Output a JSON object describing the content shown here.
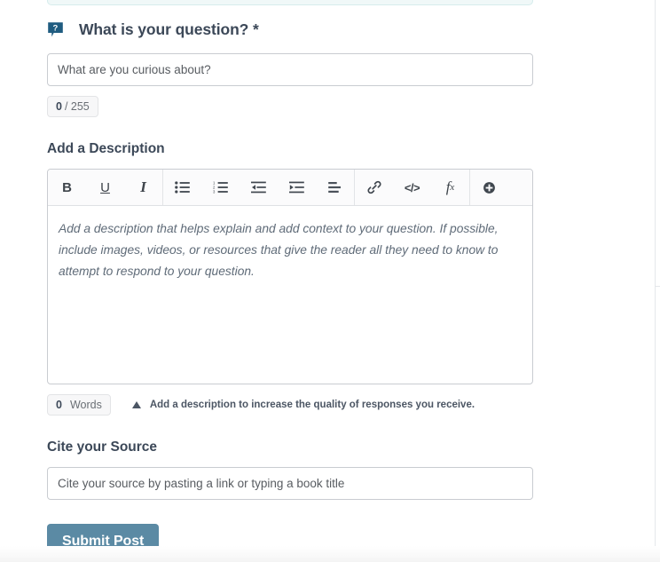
{
  "form": {
    "question": {
      "icon": "question-speech-bubble-icon",
      "label": "What is your question? *",
      "placeholder": "What are you curious about?",
      "value": "",
      "counter_current": "0",
      "counter_rest": "/ 255"
    },
    "description": {
      "heading": "Add a Description",
      "placeholder": "Add a description that helps explain and add context to your question. If possible, include images, videos, or resources that give the reader all they need to know to attempt to respond to your question.",
      "value": "",
      "word_count": "0",
      "word_unit": "Words",
      "hint": "Add a description to increase the quality of responses you receive.",
      "hint_icon": "warning-triangle-icon",
      "toolbar": [
        {
          "name": "bold-button",
          "label": "B",
          "kind": "text"
        },
        {
          "name": "underline-button",
          "label": "U",
          "kind": "text"
        },
        {
          "name": "italic-button",
          "label": "I",
          "kind": "text"
        },
        {
          "name": "bulleted-list-button",
          "label": "",
          "kind": "icon"
        },
        {
          "name": "numbered-list-button",
          "label": "",
          "kind": "icon"
        },
        {
          "name": "outdent-button",
          "label": "",
          "kind": "icon"
        },
        {
          "name": "indent-button",
          "label": "",
          "kind": "icon"
        },
        {
          "name": "align-left-button",
          "label": "",
          "kind": "icon"
        },
        {
          "name": "link-button",
          "label": "",
          "kind": "icon"
        },
        {
          "name": "code-button",
          "label": "</>",
          "kind": "text"
        },
        {
          "name": "formula-button",
          "label": "fx",
          "kind": "text"
        },
        {
          "name": "insert-button",
          "label": "",
          "kind": "icon"
        }
      ]
    },
    "source": {
      "heading": "Cite your Source",
      "placeholder": "Cite your source by pasting a link or typing a book title",
      "value": ""
    },
    "submit_label": "Submit Post"
  },
  "colors": {
    "accent": "#5b8aa4",
    "icon_blue": "#1f5c80",
    "text": "#3c4858",
    "border": "#c9ccd1"
  }
}
